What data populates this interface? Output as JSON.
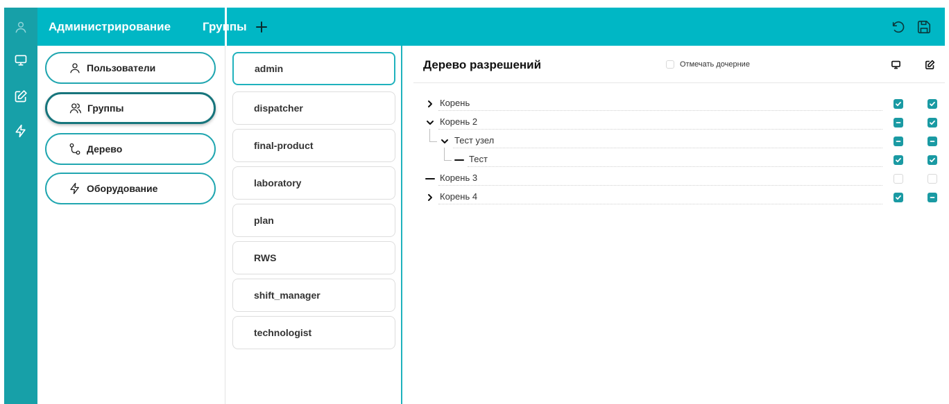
{
  "rail": {
    "icons": [
      "user-icon",
      "monitor-icon",
      "edit-icon",
      "lightning-icon"
    ]
  },
  "header": {
    "section_title": "Администрирование",
    "groups_title": "Группы"
  },
  "nav": {
    "items": [
      {
        "label": "Пользователи",
        "icon": "user-icon"
      },
      {
        "label": "Группы",
        "icon": "users-icon",
        "active": true
      },
      {
        "label": "Дерево",
        "icon": "route-icon"
      },
      {
        "label": "Оборудование",
        "icon": "lightning-icon"
      }
    ]
  },
  "groups": {
    "items": [
      "admin",
      "dispatcher",
      "final-product",
      "laboratory",
      "plan",
      "RWS",
      "shift_manager",
      "technologist"
    ],
    "selected": "admin"
  },
  "tree": {
    "title": "Дерево разрешений",
    "mark_children_label": "Отмечать дочерние",
    "columns": [
      "monitor-icon",
      "edit-icon"
    ],
    "rows": [
      {
        "label": "Корень",
        "toggle": "collapsed",
        "view": "checked",
        "edit": "checked"
      },
      {
        "label": "Корень 2",
        "toggle": "expanded",
        "view": "partial",
        "edit": "checked"
      },
      {
        "label": "Тест узел",
        "toggle": "expanded",
        "view": "partial",
        "edit": "partial"
      },
      {
        "label": "Тест",
        "toggle": "leaf",
        "view": "checked",
        "edit": "checked"
      },
      {
        "label": "Корень 3",
        "toggle": "leaf",
        "view": "empty",
        "edit": "empty"
      },
      {
        "label": "Корень 4",
        "toggle": "collapsed",
        "view": "checked",
        "edit": "partial"
      }
    ]
  },
  "colors": {
    "header": "#00b7c5",
    "rail": "#17a0a8",
    "accent": "#1a9aa3"
  }
}
